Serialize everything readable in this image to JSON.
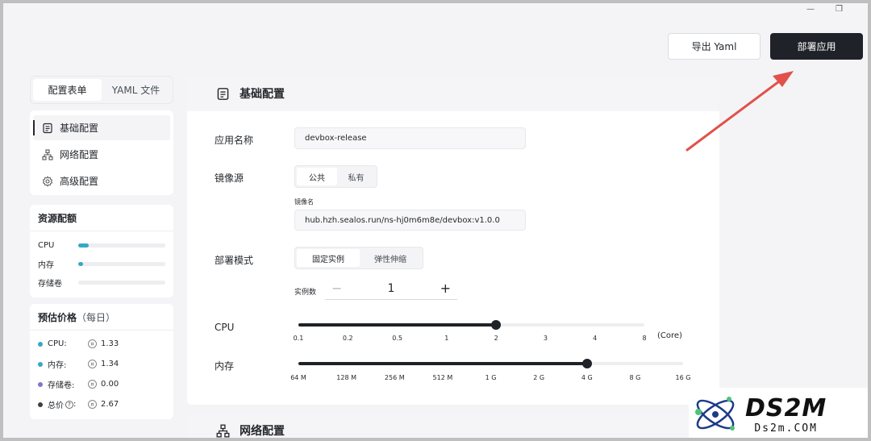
{
  "toolbar": {
    "export_label": "导出 Yaml",
    "deploy_label": "部署应用"
  },
  "tabs": [
    {
      "label": "配置表单"
    },
    {
      "label": "YAML 文件"
    }
  ],
  "nav": {
    "items": [
      {
        "label": "基础配置"
      },
      {
        "label": "网络配置"
      },
      {
        "label": "高级配置"
      }
    ]
  },
  "resources": {
    "title": "资源配额",
    "rows": [
      {
        "label": "CPU",
        "fraction": 0.12
      },
      {
        "label": "内存",
        "fraction": 0.06
      },
      {
        "label": "存储卷",
        "fraction": 0
      }
    ],
    "bar_color": "#36a9c4"
  },
  "price": {
    "title": "预估价格",
    "subtitle": "（每日）",
    "rows": [
      {
        "label": "CPU:",
        "value": "1.33",
        "color": "#36a9c4"
      },
      {
        "label": "内存:",
        "value": "1.34",
        "color": "#36a9c4"
      },
      {
        "label": "存储卷:",
        "value": "0.00",
        "color": "#8a6fd1"
      },
      {
        "label": "总价",
        "value": "2.67",
        "color": "#3c4046",
        "help": "?",
        "suffix": ":"
      }
    ]
  },
  "basic": {
    "title": "基础配置",
    "app_name_label": "应用名称",
    "app_name_value": "devbox-release",
    "image_source_label": "镜像源",
    "image_source_options": [
      "公共",
      "私有"
    ],
    "image_name_label": "镜像名",
    "image_name_value": "hub.hzh.sealos.run/ns-hj0m6m8e/devbox:v1.0.0",
    "deploy_mode_label": "部署模式",
    "deploy_mode_options": [
      "固定实例",
      "弹性伸缩"
    ],
    "instance_label": "实例数",
    "instance_minus": "−",
    "instance_value": "1",
    "instance_plus": "+",
    "cpu_label": "CPU",
    "cpu_ticks": [
      "0.1",
      "0.2",
      "0.5",
      "1",
      "2",
      "3",
      "4",
      "8"
    ],
    "cpu_value_index": 4,
    "cpu_unit": "(Core)",
    "mem_label": "内存",
    "mem_ticks": [
      "64 M",
      "128 M",
      "256 M",
      "512 M",
      "1 G",
      "2 G",
      "4 G",
      "8 G",
      "16 G"
    ],
    "mem_value_index": 6
  },
  "network": {
    "title": "网络配置"
  },
  "window_controls": {
    "minimize": "—",
    "restore": "❐"
  },
  "watermark": {
    "brand": "DS2M",
    "url": "Ds2m.COM"
  },
  "colors": {
    "primary": "#1f2228",
    "accent": "#36a9c4",
    "annotation_arrow": "#e0524a"
  }
}
